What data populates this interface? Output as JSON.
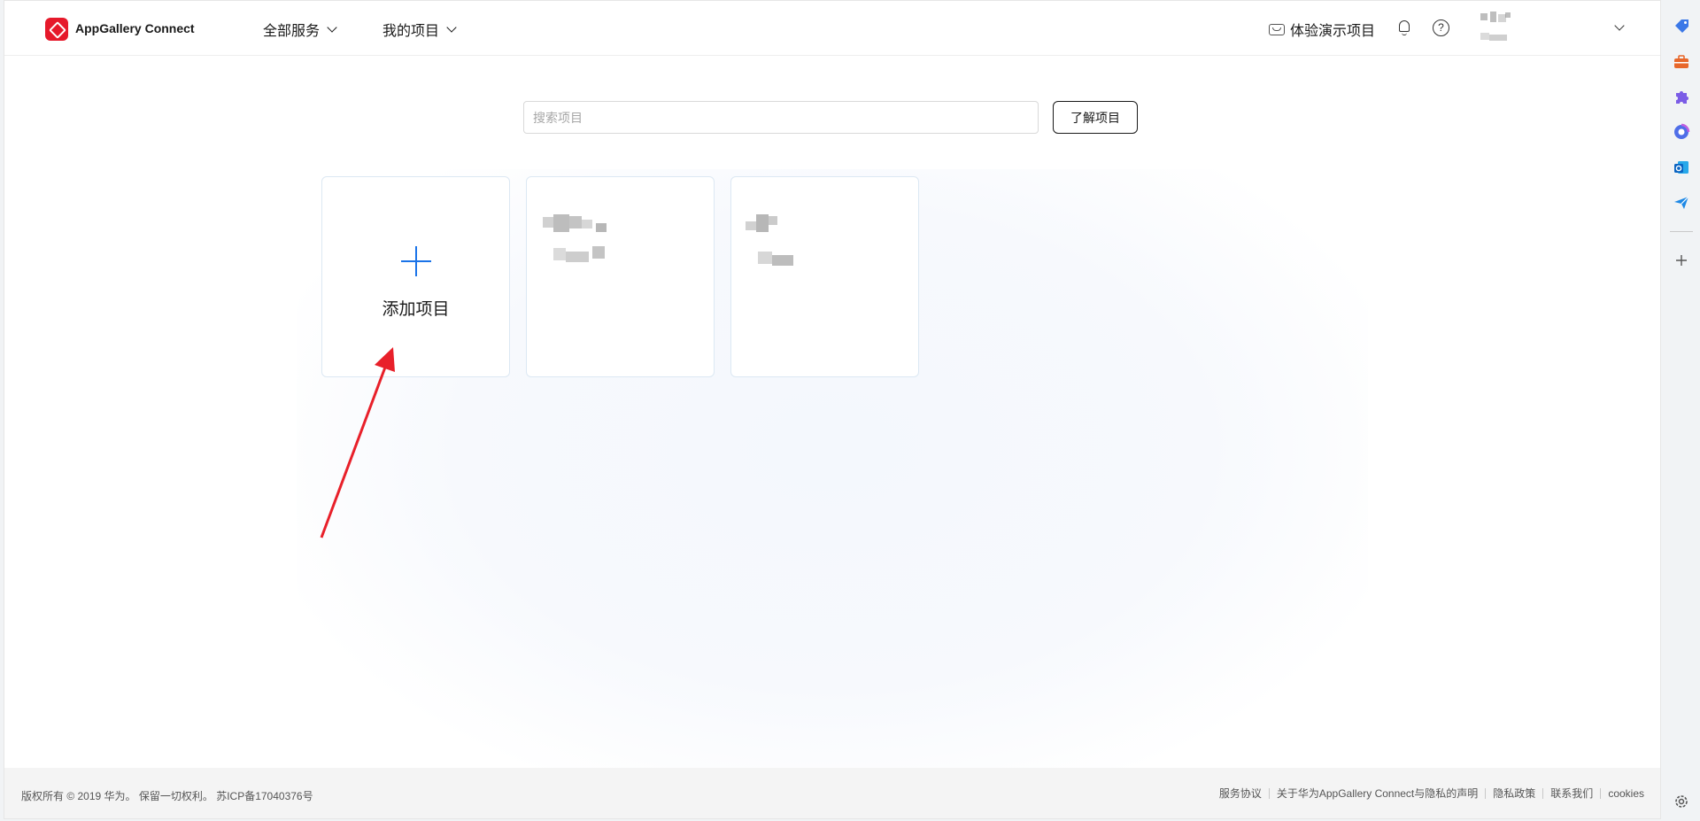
{
  "header": {
    "brand": "AppGallery Connect",
    "nav": [
      {
        "label": "全部服务"
      },
      {
        "label": "我的项目"
      }
    ],
    "demo_label": "体验演示项目"
  },
  "search": {
    "placeholder": "搜索项目",
    "learn_button": "了解项目"
  },
  "projects": {
    "add_label": "添加项目"
  },
  "footer": {
    "copyright": "版权所有 © 2019 华为。 保留一切权利。 苏ICP备17040376号",
    "links": [
      "服务协议",
      "关于华为AppGallery Connect与隐私的声明",
      "隐私政策",
      "联系我们",
      "cookies"
    ]
  },
  "colors": {
    "brand_red": "#e6192b",
    "plus_blue": "#1a73e8",
    "arrow_red": "#e8202a"
  }
}
